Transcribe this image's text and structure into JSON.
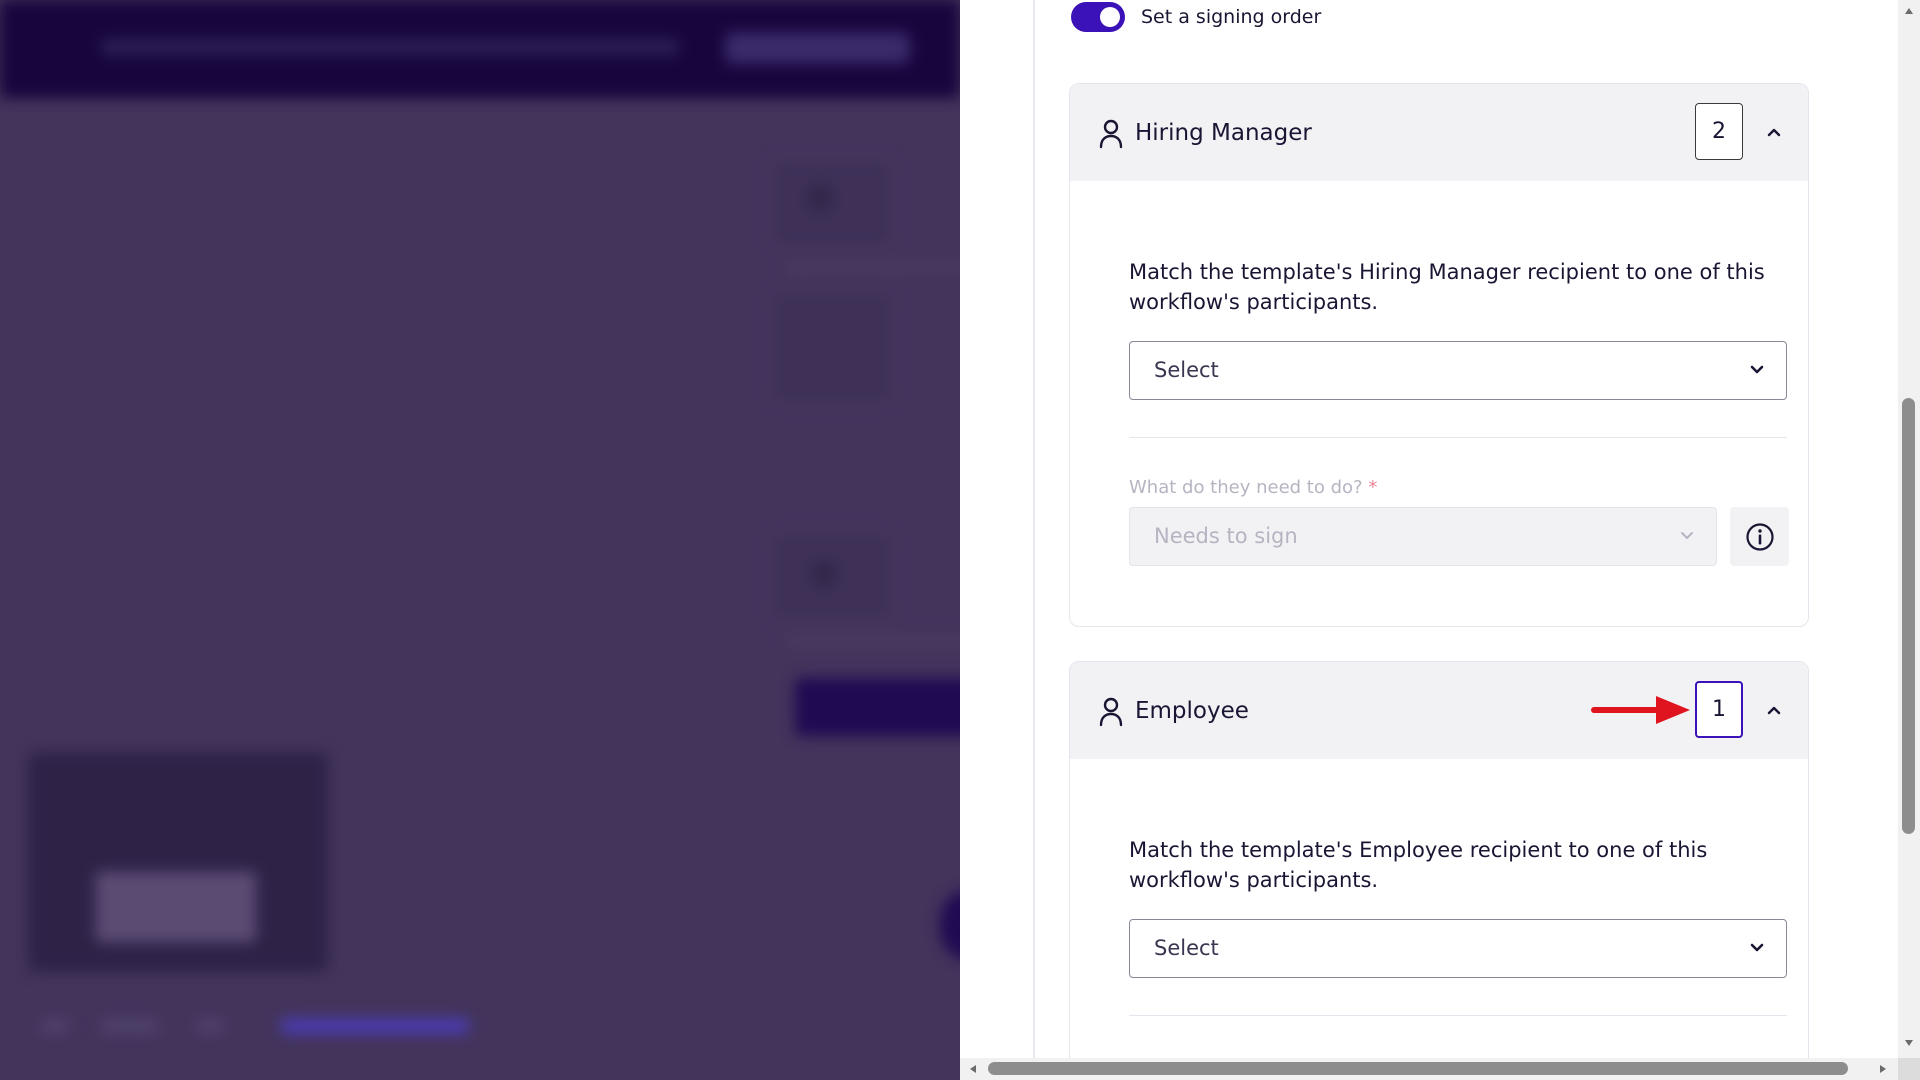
{
  "panel": {
    "signing_order_toggle": {
      "label": "Set a signing order",
      "on": true
    },
    "recipients": [
      {
        "role": "Hiring Manager",
        "order": "2",
        "match_text": "Match the template's Hiring Manager recipient to one of this workflow's participants.",
        "participant_select": "Select",
        "action_label": "What do they need to do?",
        "required_mark": "*",
        "action_value": "Needs to sign"
      },
      {
        "role": "Employee",
        "order": "1",
        "match_text": "Match the template's Employee recipient to one of this workflow's participants.",
        "participant_select": "Select"
      }
    ]
  },
  "icons": [
    "person-icon",
    "chevron-up-icon",
    "chevron-down-icon",
    "info-icon",
    "red-arrow-annotation"
  ],
  "colors": {
    "accent": "#3b12b7",
    "backdrop": "#43345c",
    "annotation": "#e0141e"
  }
}
